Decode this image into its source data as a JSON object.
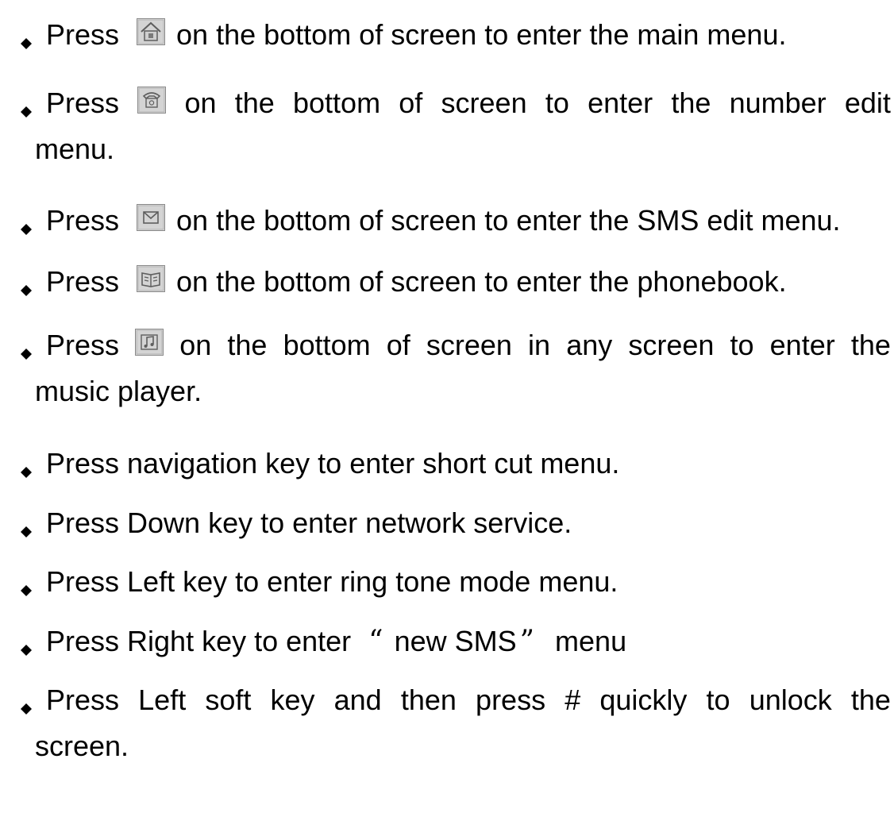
{
  "items": [
    {
      "press": "Press",
      "icon": "home-icon",
      "rest": "on the bottom of screen to enter the main menu."
    },
    {
      "press": "Press",
      "icon": "phone-icon",
      "words": [
        "on",
        "the",
        "bottom",
        "of",
        "screen",
        "to",
        "enter",
        "the",
        "number",
        "edit"
      ],
      "cont": "menu."
    },
    {
      "press": "Press",
      "icon": "message-icon",
      "rest": "on the bottom of screen to enter the SMS edit menu."
    },
    {
      "press": "Press",
      "icon": "phonebook-icon",
      "rest": "on the bottom of screen to enter the phonebook."
    },
    {
      "press": "Press",
      "icon": "music-icon",
      "words": [
        "on",
        "the",
        "bottom",
        "of",
        "screen",
        "in",
        "any",
        "screen",
        "to",
        "enter",
        "the"
      ],
      "cont": "music player."
    },
    {
      "text": "Press navigation key to enter short cut menu."
    },
    {
      "text": "Press Down key to enter network service."
    },
    {
      "text": "Press Left key to enter ring tone mode menu."
    },
    {
      "before": "Press Right key to enter",
      "open_quote": "“",
      "quoted": "new SMS",
      "close_quote": "”",
      "after": "menu"
    },
    {
      "words": [
        "Press",
        "Left",
        "soft",
        "key",
        "and",
        "then",
        "press",
        "#",
        "quickly",
        "to",
        "unlock",
        "the"
      ],
      "cont": "screen."
    }
  ]
}
